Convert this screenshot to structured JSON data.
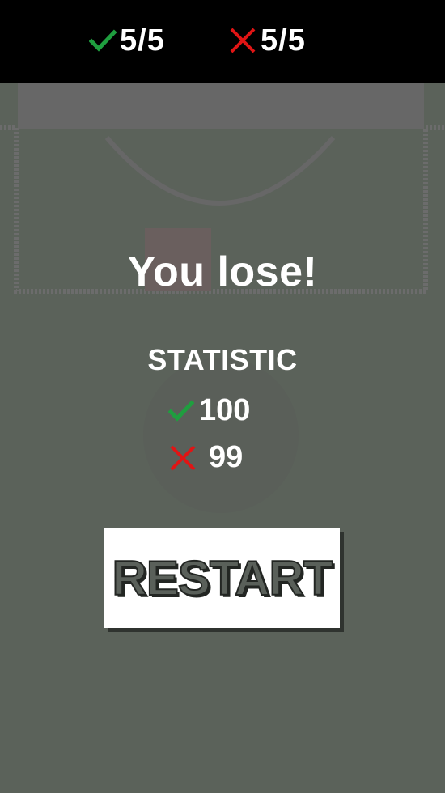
{
  "hud": {
    "correct_icon": "check-icon",
    "correct_score": "5/5",
    "wrong_icon": "cross-icon",
    "wrong_score": "5/5"
  },
  "result": {
    "title": "You lose!"
  },
  "statistic": {
    "title": "STATISTIC",
    "correct_count": "100",
    "wrong_count": "99"
  },
  "restart": {
    "label": "RESTART"
  },
  "colors": {
    "correct": "#1f9e3f",
    "wrong": "#e01515",
    "background": "#5b625a",
    "hud_background": "#000000"
  }
}
